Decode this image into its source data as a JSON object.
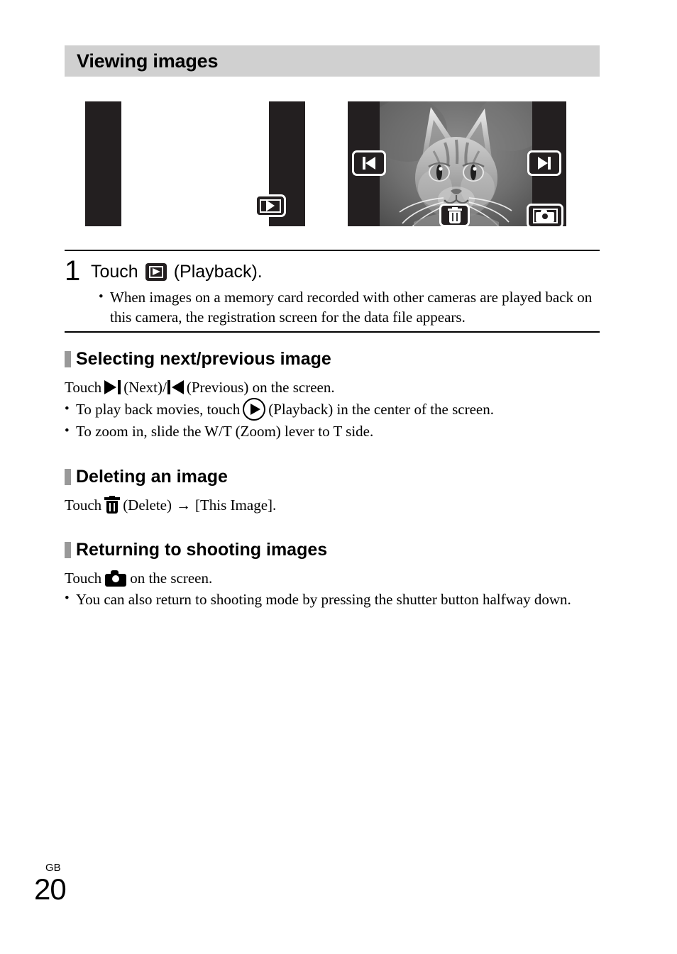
{
  "page": {
    "title": "Viewing images",
    "footer_region": "GB",
    "footer_number": "20"
  },
  "illustrations": {
    "screen1": {
      "name": "shooting-screen",
      "buttons": [
        {
          "icon": "playback-icon",
          "label": "Playback"
        }
      ]
    },
    "screen2": {
      "name": "playback-screen",
      "photo_subject": "cat",
      "buttons": [
        {
          "icon": "previous-icon",
          "label": "Previous"
        },
        {
          "icon": "next-icon",
          "label": "Next"
        },
        {
          "icon": "delete-icon",
          "label": "Delete"
        },
        {
          "icon": "camera-icon",
          "label": "Shooting"
        }
      ]
    }
  },
  "step": {
    "number": "1",
    "head_pre": "Touch",
    "head_icon": "playback-icon",
    "head_post": "(Playback).",
    "bullets": [
      {
        "dot": "•",
        "text": "When images on a memory card recorded with other cameras are played back on this camera, the registration screen for the data file appears."
      }
    ]
  },
  "sections": [
    {
      "id": "selecting-next-previous-image",
      "heading": "Selecting next/previous image",
      "lead": {
        "pre": "Touch",
        "icon_next": "next-icon",
        "mid1": "(Next)/",
        "icon_prev": "previous-icon",
        "post": "(Previous) on the screen."
      },
      "bullets": [
        {
          "dot": "•",
          "pre": "To play back movies, touch",
          "icon": "playback-circle-icon",
          "post": "(Playback) in the center of the screen."
        },
        {
          "dot": "•",
          "pre": "To zoom in, slide the W/T (Zoom) lever to T side.",
          "icon": "",
          "post": ""
        }
      ]
    },
    {
      "id": "deleting-an-image",
      "heading": "Deleting an image",
      "lead": {
        "pre": "Touch",
        "icon": "delete-icon",
        "mid": "(Delete)",
        "arrow": "→",
        "post": "[This Image]."
      }
    },
    {
      "id": "returning-to-shooting-images",
      "heading": "Returning to shooting images",
      "lead": {
        "pre": "Touch",
        "icon": "camera-icon",
        "post": "on the screen."
      },
      "bullets": [
        {
          "dot": "•",
          "text": "You can also return to shooting mode by pressing the shutter button halfway down."
        }
      ]
    }
  ],
  "colors": {
    "title_bar_bg": "#d0d0d0",
    "section_marker": "#999999",
    "screen_frame": "#231f20",
    "text": "#000000"
  }
}
